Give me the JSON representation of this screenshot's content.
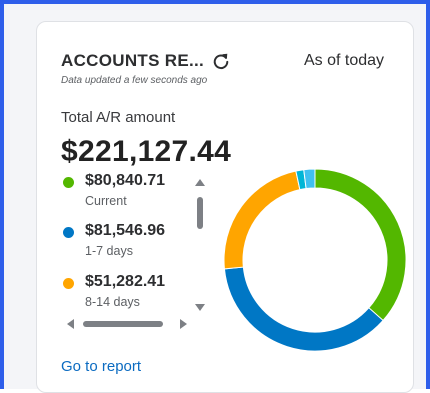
{
  "widget": {
    "title": "ACCOUNTS RE...",
    "as_of": "As of today",
    "updated": "Data updated a few seconds ago",
    "total_label": "Total A/R amount",
    "total_amount": "$221,127.44",
    "link": "Go to report"
  },
  "legend": [
    {
      "amount": "$80,840.71",
      "label": "Current",
      "color": "#53b700"
    },
    {
      "amount": "$81,546.96",
      "label": "1-7 days",
      "color": "#0077c5"
    },
    {
      "amount": "$51,282.41",
      "label": "8-14 days",
      "color": "#ffa500"
    }
  ],
  "chart_data": {
    "type": "pie",
    "style": "donut",
    "values": [
      80840.71,
      81546.96,
      51282.41,
      3100,
      4357.36
    ],
    "colors": [
      "#53b700",
      "#0077c5",
      "#ffa500",
      "#00b6d6",
      "#40c0f0"
    ]
  }
}
